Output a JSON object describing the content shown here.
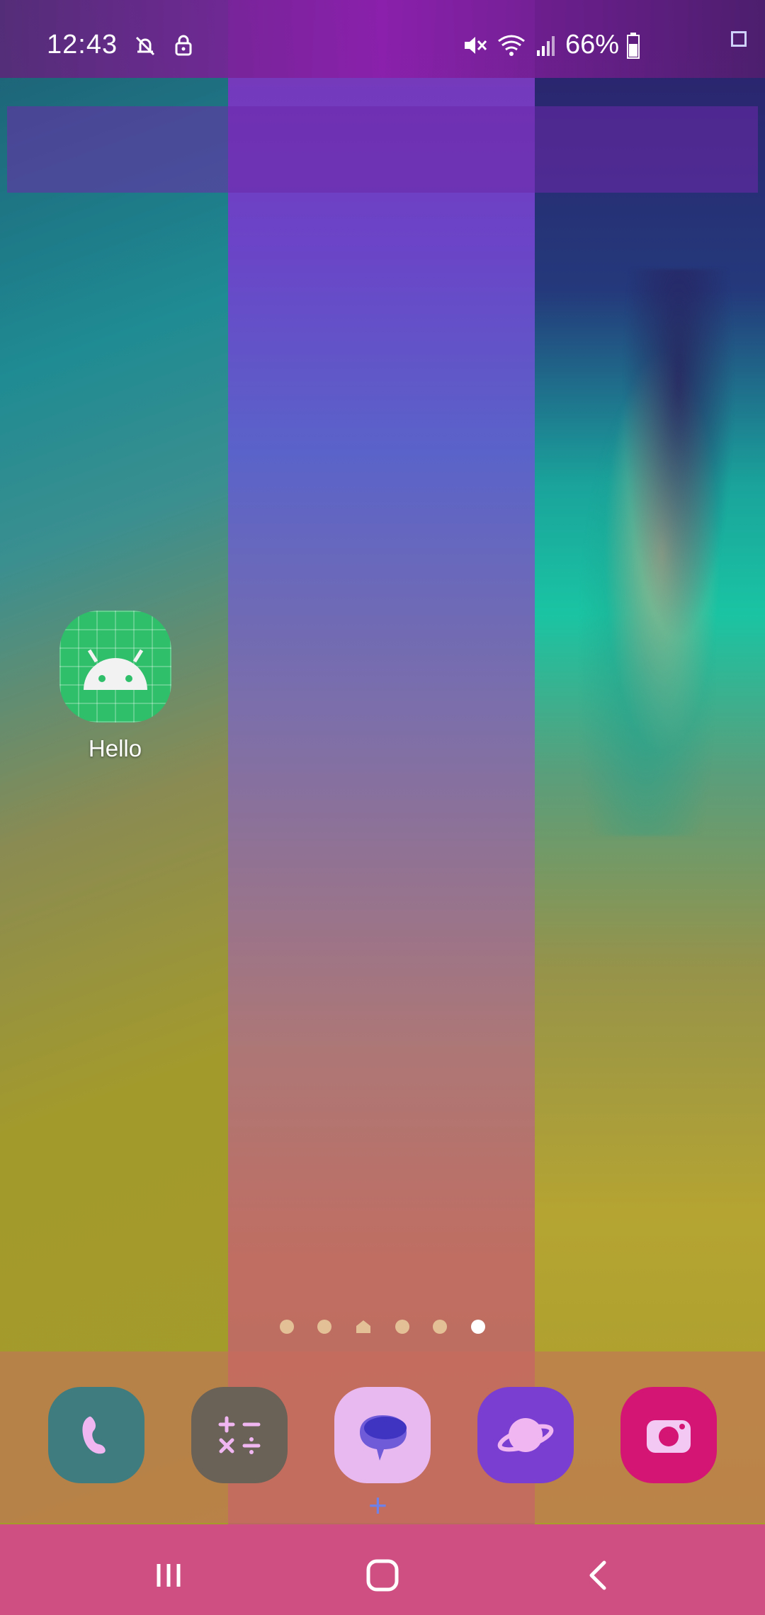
{
  "status_bar": {
    "time": "12:43",
    "battery_percent": "66%",
    "icons": [
      "notifications-off-icon",
      "lock-icon",
      "mute-icon",
      "wifi-icon",
      "signal-icon",
      "battery-icon"
    ]
  },
  "home": {
    "apps": [
      {
        "label": "Hello",
        "icon": "android-app-icon"
      }
    ],
    "pages": {
      "count": 6,
      "home_index": 2,
      "active_index": 5
    }
  },
  "dock": {
    "apps": [
      "phone-icon",
      "calculator-icon",
      "messages-icon",
      "internet-icon",
      "camera-icon"
    ]
  },
  "nav_bar": {
    "buttons": [
      "recents-icon",
      "home-icon",
      "back-icon"
    ]
  },
  "colors": {
    "phone": "#3f7c80",
    "calculator": "#6a6157",
    "messages": "#e8b8f0",
    "internet": "#7a3fd0",
    "camera": "#d41574",
    "nav_bar": "#cf4f83"
  }
}
